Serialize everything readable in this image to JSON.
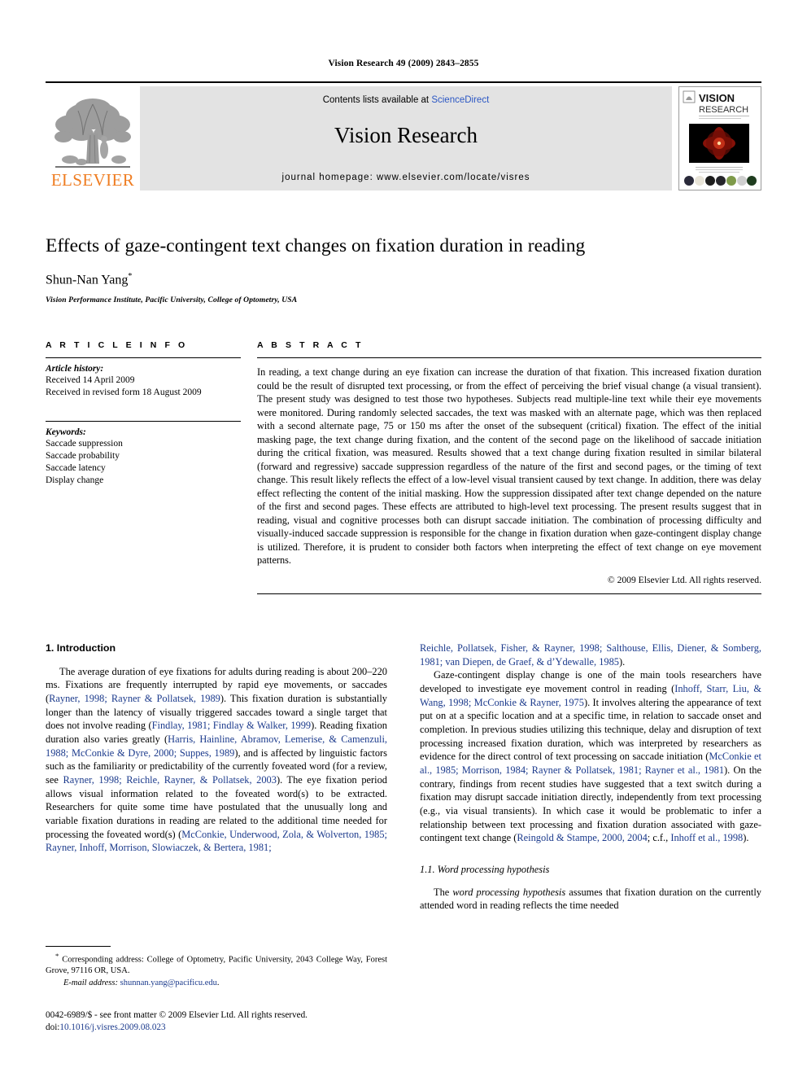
{
  "running_head": "Vision Research 49 (2009) 2843–2855",
  "masthead": {
    "publisher_name": "ELSEVIER",
    "contents_prefix": "Contents lists available at ",
    "contents_link": "ScienceDirect",
    "journal_title": "Vision Research",
    "homepage": "journal homepage: www.elsevier.com/locate/visres",
    "cover": {
      "line1": "VISION",
      "line2": "RESEARCH"
    },
    "banner_bg": "#e3e3e3",
    "link_color": "#2b57c4",
    "elsevier_orange": "#ef7d22"
  },
  "title_block": {
    "title": "Effects of gaze-contingent text changes on fixation duration in reading",
    "author": "Shun-Nan Yang",
    "author_marker": "*",
    "affiliation": "Vision Performance Institute, Pacific University, College of Optometry, USA"
  },
  "article_info": {
    "heading": "A R T I C L E  I N F O",
    "history_label": "Article history:",
    "history_lines": [
      "Received 14 April 2009",
      "Received in revised form 18 August 2009"
    ],
    "keywords_label": "Keywords:",
    "keywords": [
      "Saccade suppression",
      "Saccade probability",
      "Saccade latency",
      "Display change"
    ]
  },
  "abstract": {
    "heading": "A B S T R A C T",
    "text": "In reading, a text change during an eye fixation can increase the duration of that fixation. This increased fixation duration could be the result of disrupted text processing, or from the effect of perceiving the brief visual change (a visual transient). The present study was designed to test those two hypotheses. Subjects read multiple-line text while their eye movements were monitored. During randomly selected saccades, the text was masked with an alternate page, which was then replaced with a second alternate page, 75 or 150 ms after the onset of the subsequent (critical) fixation. The effect of the initial masking page, the text change during fixation, and the content of the second page on the likelihood of saccade initiation during the critical fixation, was measured. Results showed that a text change during fixation resulted in similar bilateral (forward and regressive) saccade suppression regardless of the nature of the first and second pages, or the timing of text change. This result likely reflects the effect of a low-level visual transient caused by text change. In addition, there was delay effect reflecting the content of the initial masking. How the suppression dissipated after text change depended on the nature of the first and second pages. These effects are attributed to high-level text processing. The present results suggest that in reading, visual and cognitive processes both can disrupt saccade initiation. The combination of processing difficulty and visually-induced saccade suppression is responsible for the change in fixation duration when gaze-contingent display change is utilized. Therefore, it is prudent to consider both factors when interpreting the effect of text change on eye movement patterns.",
    "copyright": "© 2009 Elsevier Ltd. All rights reserved."
  },
  "body": {
    "section_heading": "1. Introduction",
    "left_col": {
      "p1_a": "The average duration of eye fixations for adults during reading is about 200–220 ms. Fixations are frequently interrupted by rapid eye movements, or saccades (",
      "p1_cite1": "Rayner, 1998; Rayner & Pollatsek, 1989",
      "p1_b": "). This fixation duration is substantially longer than the latency of visually triggered saccades toward a single target that does not involve reading (",
      "p1_cite2": "Findlay, 1981; Findlay & Walker, 1999",
      "p1_c": "). Reading fixation duration also varies greatly (",
      "p1_cite3": "Harris, Hainline, Abramov, Lemerise, & Camenzuli, 1988; McConkie & Dyre, 2000; Suppes, 1989",
      "p1_d": "), and is affected by linguistic factors such as the familiarity or predictability of the currently foveated word (for a review, see ",
      "p1_cite4": "Rayner, 1998; Reichle, Rayner, & Pollatsek, 2003",
      "p1_e": "). The eye fixation period allows visual information related to the foveated word(s) to be extracted. Researchers for quite some time have postulated that the unusually long and variable fixation durations in reading are related to the additional time needed for processing the foveated word(s) (",
      "p1_cite5": "McConkie, Underwood, Zola, & Wolverton, 1985; Rayner, Inhoff, Morrison, Slowiaczek, & Bertera, 1981;",
      "p1_f": ""
    },
    "right_col": {
      "p1_cont_cite": "Reichle, Pollatsek, Fisher, & Rayner, 1998; Salthouse, Ellis, Diener, & Somberg, 1981; van Diepen, de Graef, & d’Ydewalle, 1985",
      "p1_cont_tail": ").",
      "p2_a": "Gaze-contingent display change is one of the main tools researchers have developed to investigate eye movement control in reading (",
      "p2_cite1": "Inhoff, Starr, Liu, & Wang, 1998; McConkie & Rayner, 1975",
      "p2_b": "). It involves altering the appearance of text put on at a specific location and at a specific time, in relation to saccade onset and completion. In previous studies utilizing this technique, delay and disruption of text processing increased fixation duration, which was interpreted by researchers as evidence for the direct control of text processing on saccade initiation (",
      "p2_cite2": "McConkie et al., 1985; Morrison, 1984; Rayner & Pollatsek, 1981; Rayner et al., 1981",
      "p2_c": "). On the contrary, findings from recent studies have suggested that a text switch during a fixation may disrupt saccade initiation directly, independently from text processing (e.g., via visual transients). In which case it would be problematic to infer a relationship between text processing and fixation duration associated with gaze-contingent text change (",
      "p2_cite3": "Reingold & Stampe, 2000, 2004",
      "p2_d": "; c.f., ",
      "p2_cite4": "Inhoff et al., 1998",
      "p2_e": ").",
      "sub_heading": "1.1. Word processing hypothesis",
      "p3_a": "The ",
      "p3_ital": "word processing hypothesis",
      "p3_b": " assumes that fixation duration on the currently attended word in reading reflects the time needed"
    },
    "cite_color": "#1b3a8c"
  },
  "footnotes": {
    "marker": "*",
    "correspondence": "Corresponding address: College of Optometry, Pacific University, 2043 College Way, Forest Grove, 97116 OR, USA.",
    "email_label": "E-mail address:",
    "email": "shunnan.yang@pacificu.edu",
    "email_tail": ".",
    "imprint_line1": "0042-6989/$ - see front matter © 2009 Elsevier Ltd. All rights reserved.",
    "doi_label": "doi:",
    "doi_value": "10.1016/j.visres.2009.08.023"
  }
}
